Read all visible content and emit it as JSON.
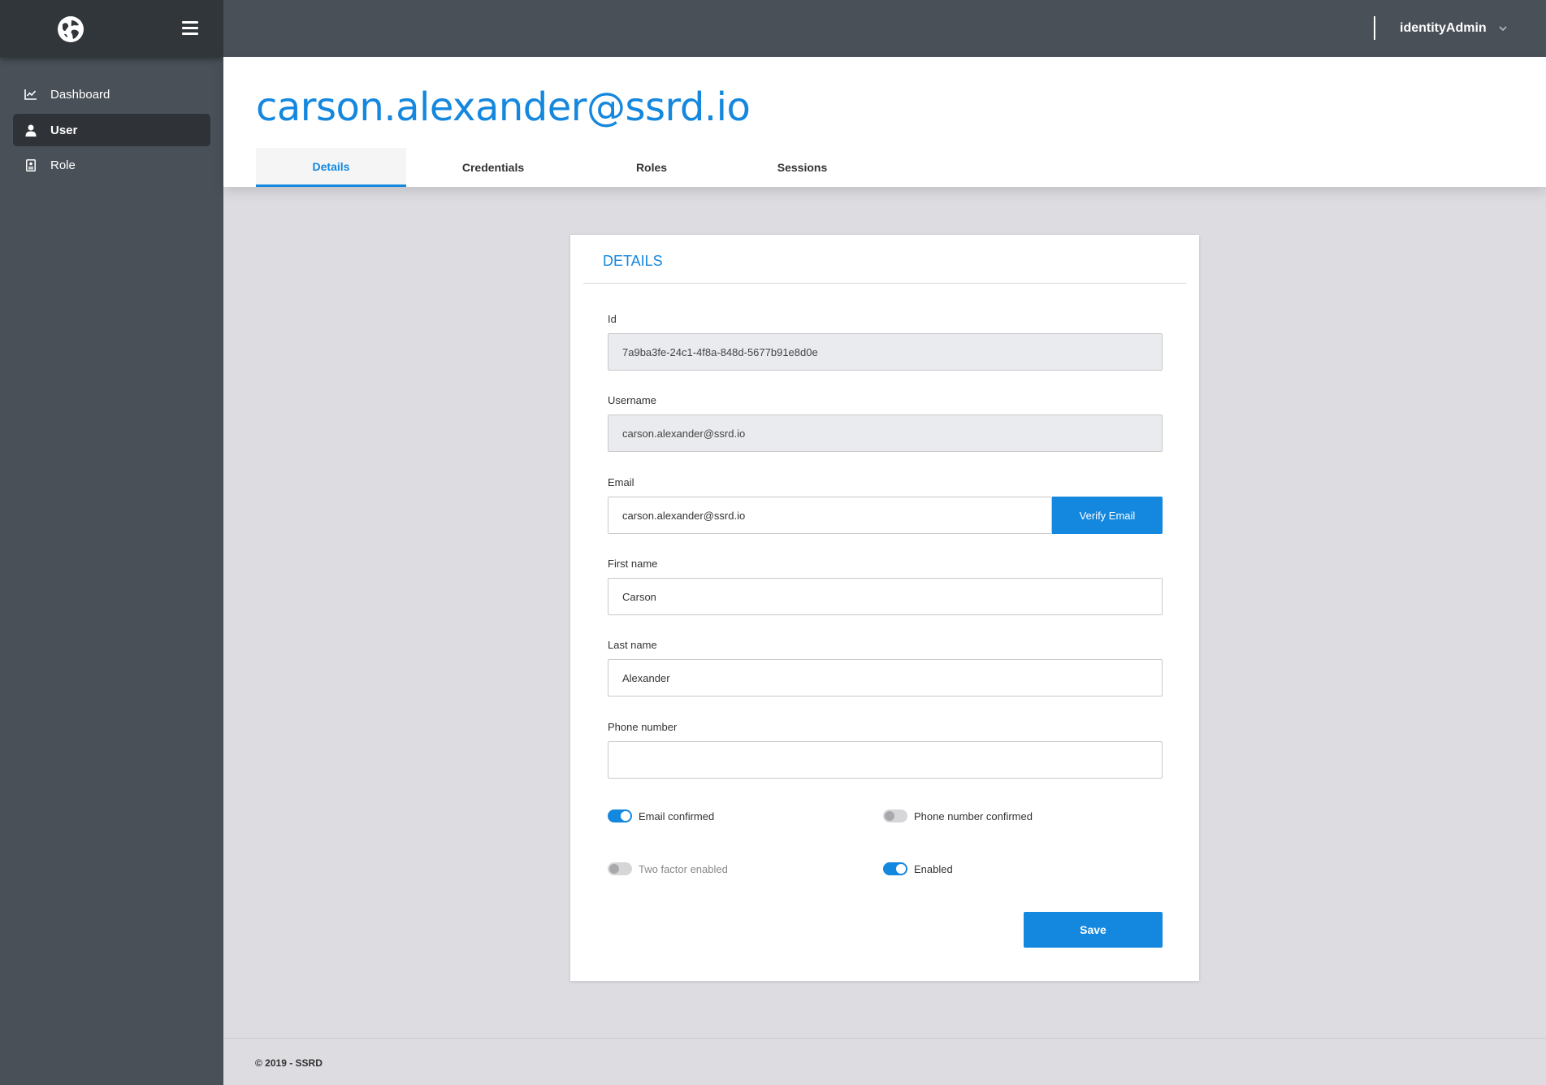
{
  "topbar": {
    "user_name": "identityAdmin"
  },
  "sidebar": {
    "items": [
      {
        "label": "Dashboard",
        "icon": "chart-line-icon"
      },
      {
        "label": "User",
        "icon": "user-icon"
      },
      {
        "label": "Role",
        "icon": "id-card-icon"
      }
    ]
  },
  "header": {
    "title": "carson.alexander@ssrd.io",
    "tabs": [
      {
        "label": "Details"
      },
      {
        "label": "Credentials"
      },
      {
        "label": "Roles"
      },
      {
        "label": "Sessions"
      }
    ]
  },
  "card": {
    "title": "DETAILS",
    "fields": {
      "id": {
        "label": "Id",
        "value": "7a9ba3fe-24c1-4f8a-848d-5677b91e8d0e"
      },
      "username": {
        "label": "Username",
        "value": "carson.alexander@ssrd.io"
      },
      "email": {
        "label": "Email",
        "value": "carson.alexander@ssrd.io",
        "button": "Verify Email"
      },
      "first_name": {
        "label": "First name",
        "value": "Carson"
      },
      "last_name": {
        "label": "Last name",
        "value": "Alexander"
      },
      "phone": {
        "label": "Phone number",
        "value": ""
      }
    },
    "toggles": {
      "email_confirmed": {
        "label": "Email confirmed",
        "on": true
      },
      "phone_confirmed": {
        "label": "Phone number confirmed",
        "on": false
      },
      "two_factor": {
        "label": "Two factor enabled",
        "on": false
      },
      "enabled": {
        "label": "Enabled",
        "on": true
      }
    },
    "save_label": "Save"
  },
  "footer": {
    "text": "© 2019 - SSRD"
  },
  "colors": {
    "accent": "#1487de",
    "sidebar": "#495058",
    "sidebar_top": "#31363b",
    "background": "#dcdce1"
  }
}
